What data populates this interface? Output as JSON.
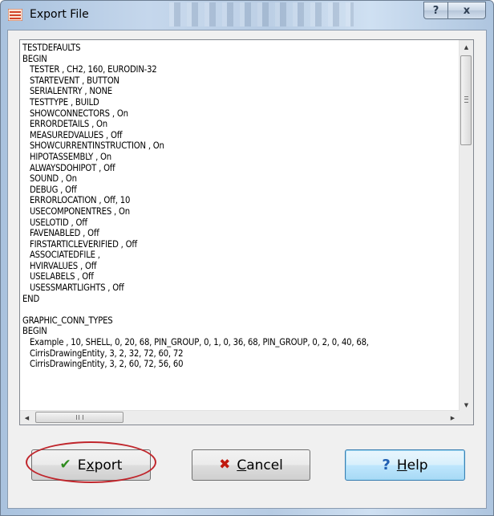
{
  "window": {
    "title": "Export File",
    "help_glyph": "?",
    "close_glyph": "x"
  },
  "content": {
    "lines": [
      "TESTDEFAULTS",
      "BEGIN",
      "   TESTER , CH2, 160, EURODIN-32",
      "   STARTEVENT , BUTTON",
      "   SERIALENTRY , NONE",
      "   TESTTYPE , BUILD",
      "   SHOWCONNECTORS , On",
      "   ERRORDETAILS , On",
      "   MEASUREDVALUES , Off",
      "   SHOWCURRENTINSTRUCTION , On",
      "   HIPOTASSEMBLY , On",
      "   ALWAYSDOHIPOT , Off",
      "   SOUND , On",
      "   DEBUG , Off",
      "   ERRORLOCATION , Off, 10",
      "   USECOMPONENTRES , On",
      "   USELOTID , Off",
      "   FAVENABLED , Off",
      "   FIRSTARTICLEVERIFIED , Off",
      "   ASSOCIATEDFILE ,",
      "   HVIRVALUES , Off",
      "   USELABELS , Off",
      "   USESSMARTLIGHTS , Off",
      "END",
      "",
      "GRAPHIC_CONN_TYPES",
      "BEGIN",
      "   Example , 10, SHELL, 0, 20, 68, PIN_GROUP, 0, 1, 0, 36, 68, PIN_GROUP, 0, 2, 0, 40, 68,",
      "   CirrisDrawingEntity, 3, 2, 32, 72, 60, 72",
      "   CirrisDrawingEntity, 3, 2, 60, 72, 56, 60"
    ]
  },
  "scrollbar": {
    "up_arrow": "▲",
    "down_arrow": "▼",
    "left_arrow": "◀",
    "right_arrow": "▶"
  },
  "buttons": {
    "export": {
      "prefix": "E",
      "underline": "x",
      "suffix": "port",
      "icon": "✔"
    },
    "cancel": {
      "prefix": "",
      "underline": "C",
      "suffix": "ancel",
      "icon": "✖"
    },
    "help": {
      "prefix": "",
      "underline": "H",
      "suffix": "elp",
      "icon": "?"
    }
  },
  "colors": {
    "highlight_ring": "#c0262c",
    "export_icon": "#2e8b1e",
    "cancel_icon": "#c0190e",
    "help_icon": "#1f5fb2"
  }
}
